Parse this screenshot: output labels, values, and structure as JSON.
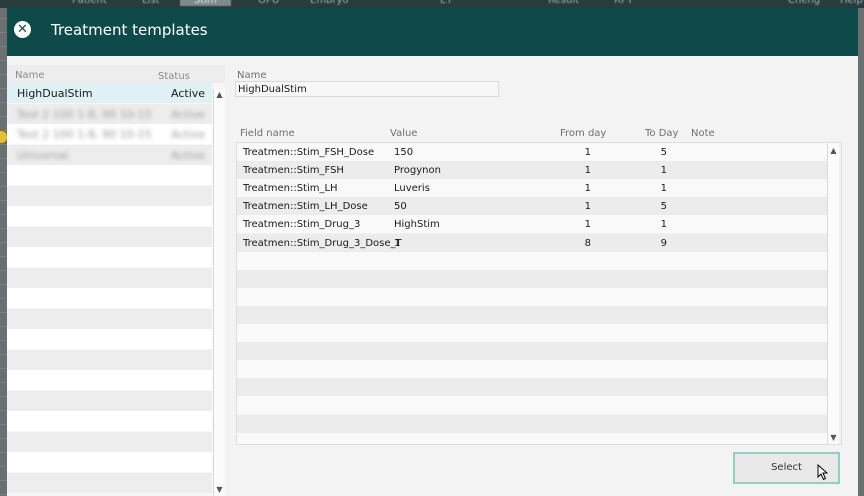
{
  "background": {
    "tabs": [
      "Patient",
      "List",
      "Stim",
      "OPU",
      "Embryo",
      "ET",
      "Result",
      "RPT",
      "Cheng",
      "Help"
    ],
    "active_tab": "Stim"
  },
  "modal": {
    "title": "Treatment templates",
    "close_icon": "close-icon"
  },
  "template_list": {
    "headers": {
      "name": "Name",
      "status": "Status"
    },
    "rows": [
      {
        "name": "HighDualStim",
        "status": "Active",
        "selected": true,
        "blurred": false
      },
      {
        "name": "Test 2 100 1-8, 90 10-15",
        "status": "Active",
        "selected": false,
        "blurred": true
      },
      {
        "name": "Test 2 100 1-8, 90 10-15",
        "status": "Active",
        "selected": false,
        "blurred": true
      },
      {
        "name": "Universal",
        "status": "Active",
        "selected": false,
        "blurred": true
      }
    ],
    "total_rows": 20
  },
  "detail": {
    "name_label": "Name",
    "name_value": "HighDualStim",
    "columns": {
      "field": "Field name",
      "value": "Value",
      "from": "From day",
      "to": "To Day",
      "note": "Note"
    },
    "rows": [
      {
        "field": "Treatmen::Stim_FSH_Dose",
        "value": "150",
        "from": "1",
        "to": "5",
        "note": ""
      },
      {
        "field": "Treatmen::Stim_FSH",
        "value": "Progynon",
        "from": "1",
        "to": "1",
        "note": ""
      },
      {
        "field": "Treatmen::Stim_LH",
        "value": "Luveris",
        "from": "1",
        "to": "1",
        "note": ""
      },
      {
        "field": "Treatmen::Stim_LH_Dose",
        "value": "50",
        "from": "1",
        "to": "5",
        "note": ""
      },
      {
        "field": "Treatmen::Stim_Drug_3",
        "value": "HighStim",
        "from": "1",
        "to": "1",
        "note": ""
      },
      {
        "field": "Treatmen::Stim_Drug_3_Dose_T",
        "value": "1",
        "from": "8",
        "to": "9",
        "note": ""
      }
    ],
    "total_rows": 17
  },
  "actions": {
    "select_label": "Select"
  },
  "colors": {
    "header": "#0f4a4b",
    "selected_row": "#dff1f4",
    "button_border": "#8fd0c4"
  }
}
